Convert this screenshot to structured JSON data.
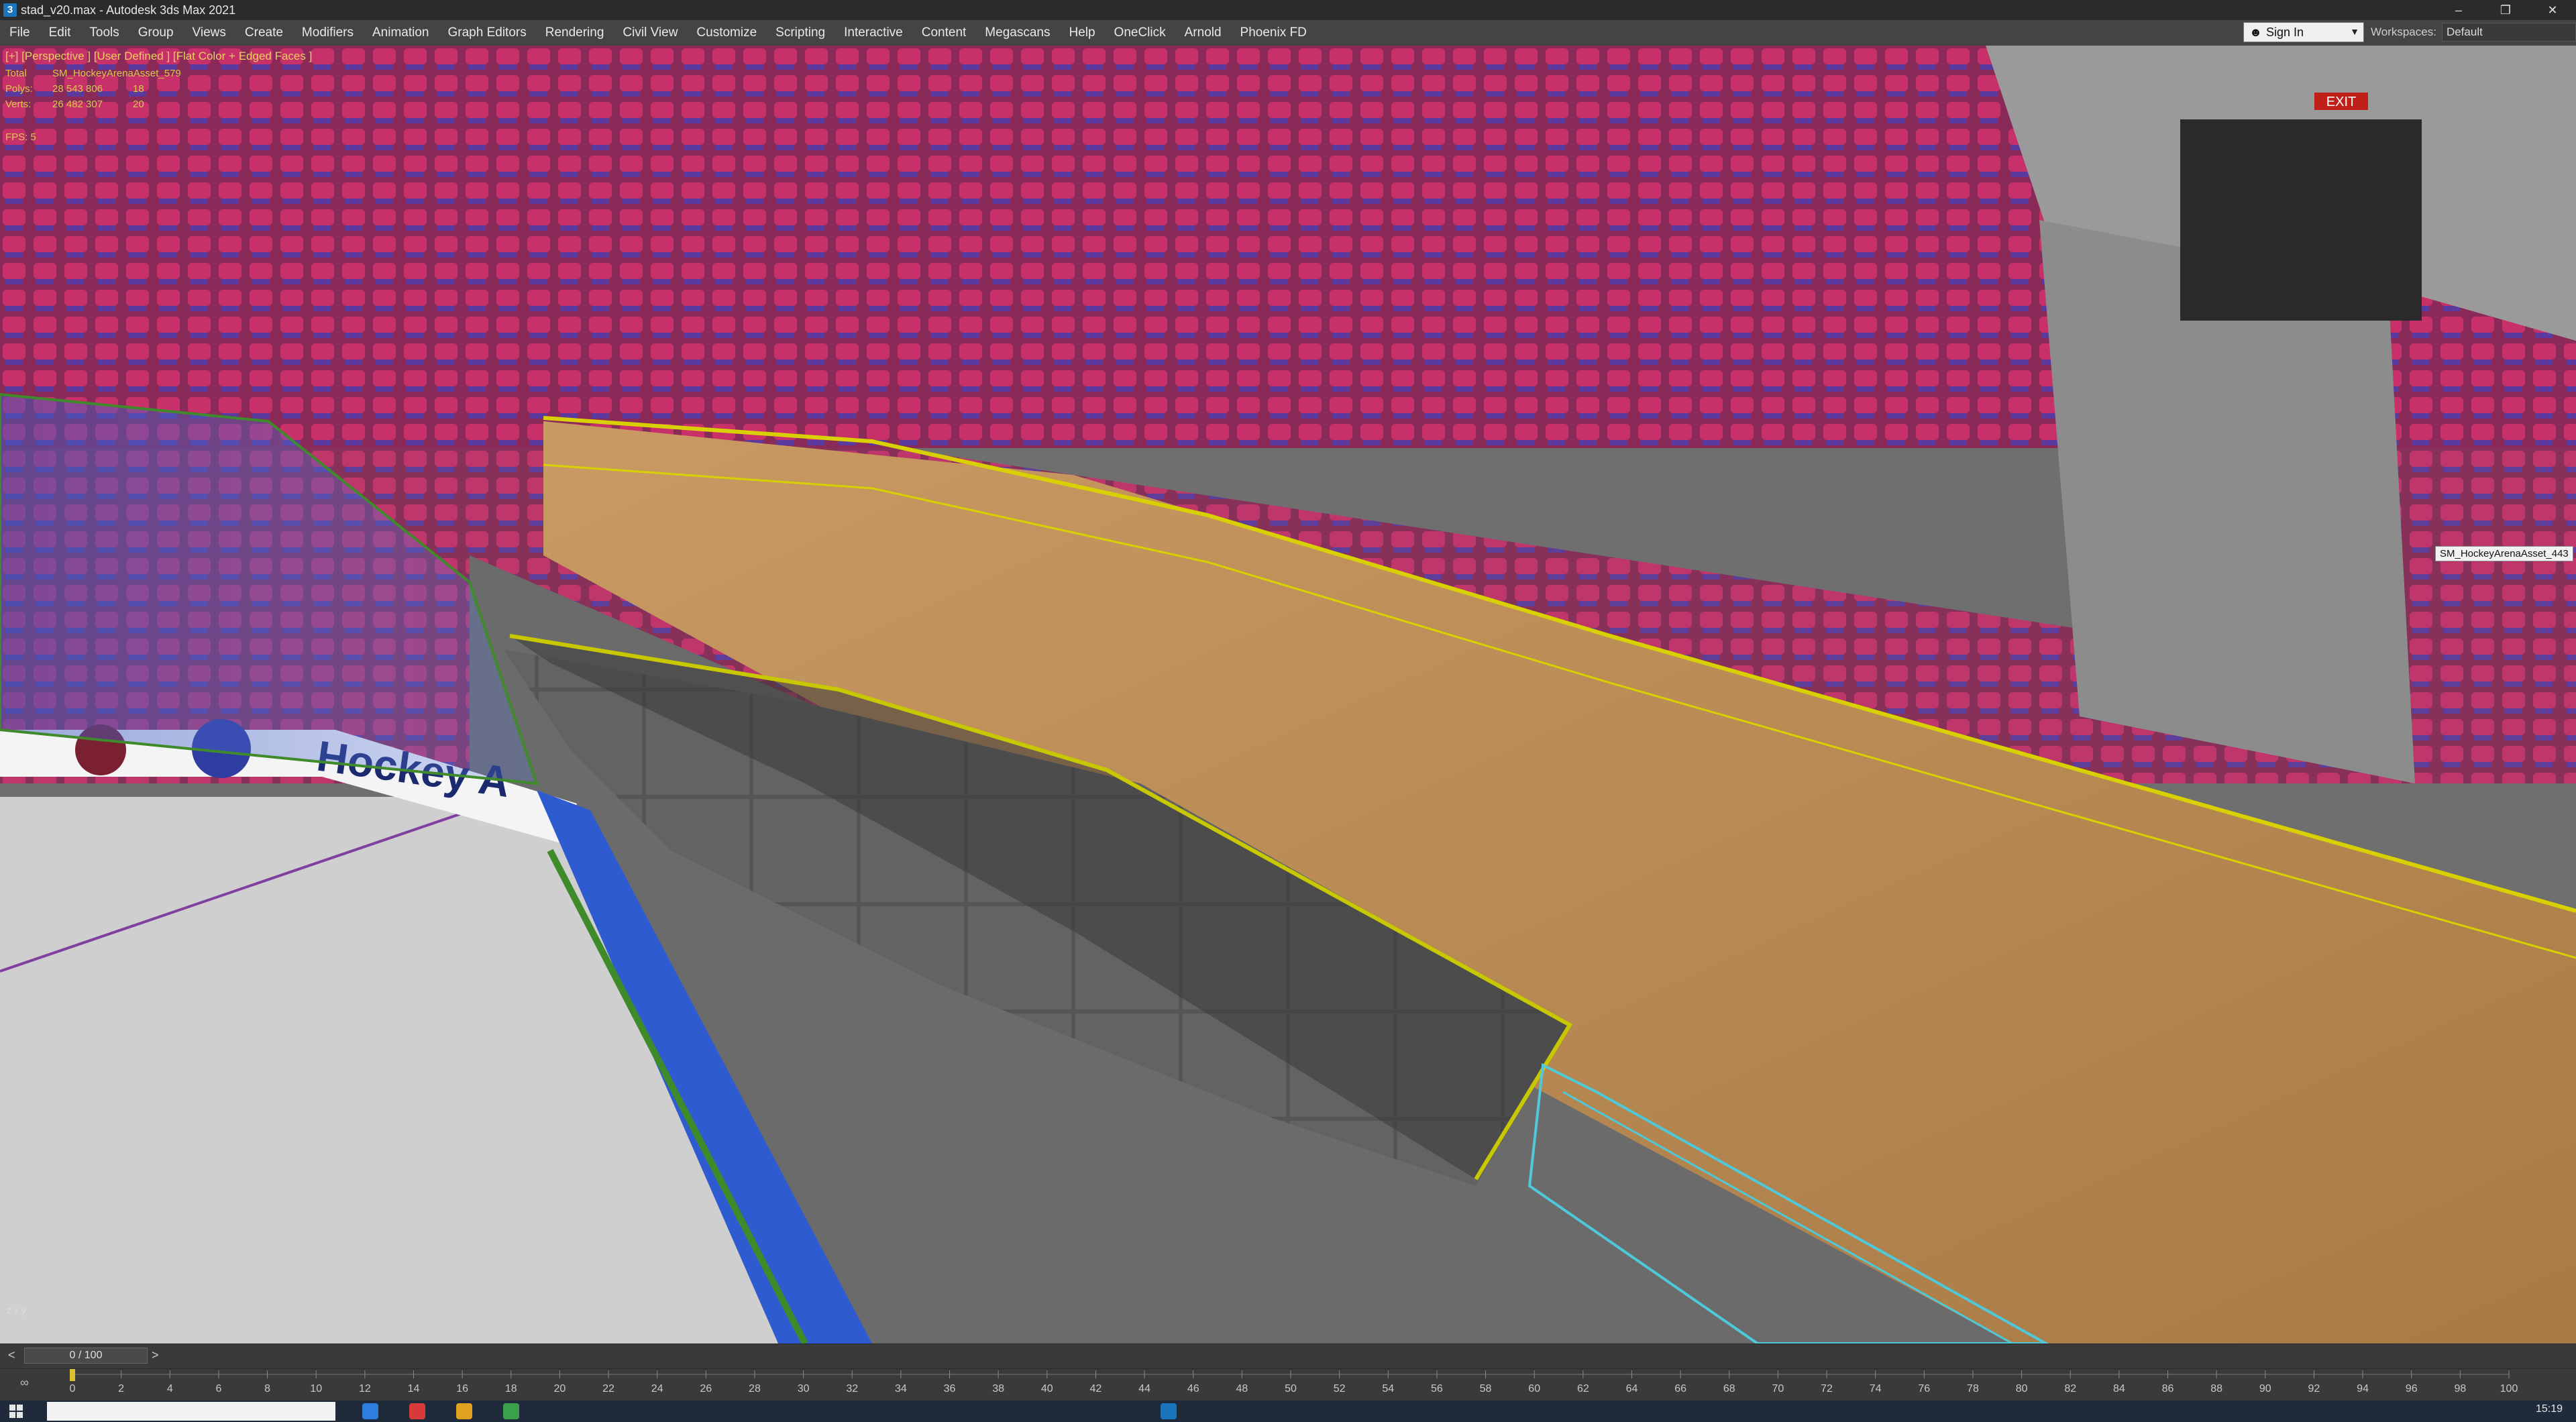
{
  "window": {
    "title": "stad_v20.max - Autodesk 3ds Max 2021",
    "controls": [
      "–",
      "❐",
      "✕"
    ]
  },
  "menu": [
    "File",
    "Edit",
    "Tools",
    "Group",
    "Views",
    "Create",
    "Modifiers",
    "Animation",
    "Graph Editors",
    "Rendering",
    "Civil View",
    "Customize",
    "Scripting",
    "Interactive",
    "Content",
    "Megascans",
    "Help",
    "OneClick",
    "Arnold",
    "Phoenix FD"
  ],
  "signin": {
    "label": "Sign In"
  },
  "workspaces": {
    "label": "Workspaces:",
    "value": "Default"
  },
  "viewport": {
    "label": "[+] [Perspective ] [User Defined ] [Flat Color + Edged Faces ]",
    "stats": {
      "total_label": "Total",
      "total_value": "SM_HockeyArenaAsset_579",
      "polys_label": "Polys:",
      "polys_value": "28 543 806",
      "polys_sel": "18",
      "verts_label": "Verts:",
      "verts_value": "26 482 307",
      "verts_sel": "20",
      "fps_label": "FPS:",
      "fps_value": "5"
    },
    "tooltip": "SM_HockeyArenaAsset_443",
    "board_text": "Hockey A",
    "exit_sign": "EXIT",
    "axis": "z\nx y"
  },
  "timeslider": {
    "frame": "0 / 100",
    "prev": "<",
    "next": ">"
  },
  "trackbar": {
    "ticks": [
      "0",
      "2",
      "4",
      "6",
      "8",
      "10",
      "12",
      "14",
      "16",
      "18",
      "20",
      "22",
      "24",
      "26",
      "28",
      "30",
      "32",
      "34",
      "36",
      "38",
      "40",
      "42",
      "44",
      "46",
      "48",
      "50",
      "52",
      "54",
      "56",
      "58",
      "60",
      "62",
      "64",
      "66",
      "68",
      "70",
      "72",
      "74",
      "76",
      "78",
      "80",
      "82",
      "84",
      "86",
      "88",
      "90",
      "92",
      "94",
      "96",
      "98",
      "100"
    ]
  },
  "taskbar": {
    "clock": "15:19"
  },
  "colors": {
    "seats": "#b8285e",
    "wood": "#b98a55",
    "concrete": "#6a6a6a",
    "ice": "#cfcfcf",
    "glass_blue": "#2f5bd0",
    "highlight_yellow": "#d8d000"
  }
}
